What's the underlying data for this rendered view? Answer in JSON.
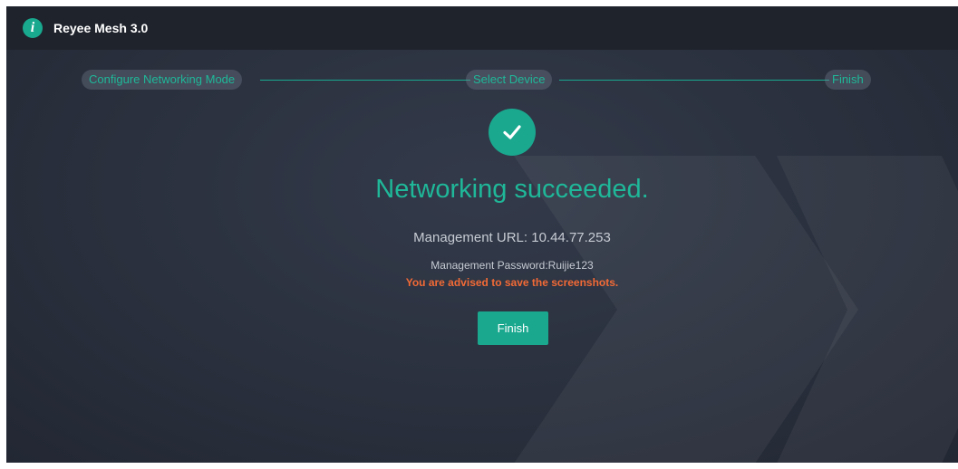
{
  "header": {
    "logo_icon": "info-icon",
    "logo_glyph": "i",
    "title": "Reyee Mesh 3.0"
  },
  "steps": [
    {
      "label": "Configure Networking Mode"
    },
    {
      "label": "Select Device"
    },
    {
      "label": "Finish"
    }
  ],
  "result": {
    "icon": "check-circle-icon",
    "headline": "Networking succeeded.",
    "management_url": "Management URL: 10.44.77.253",
    "management_password": "Management Password:Ruijie123",
    "advice": "You are advised to save the screenshots."
  },
  "actions": {
    "finish_label": "Finish"
  },
  "colors": {
    "accent": "#1aa88f",
    "warning": "#f26a36",
    "background": "#2a303d",
    "topbar": "#1f232c"
  }
}
